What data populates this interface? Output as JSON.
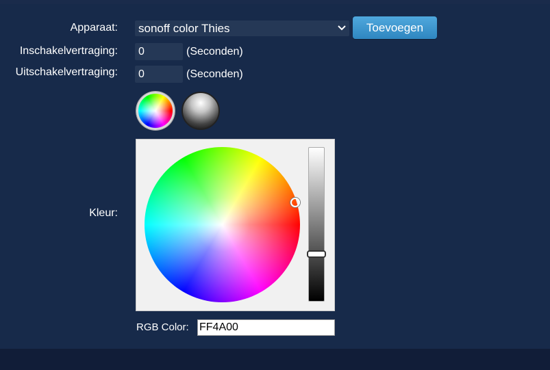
{
  "form": {
    "device_label": "Apparaat:",
    "device_value": "sonoff color Thies",
    "add_button": "Toevoegen",
    "on_delay_label": "Inschakelvertraging:",
    "on_delay_value": "0",
    "on_delay_unit": "(Seconden)",
    "off_delay_label": "Uitschakelvertraging:",
    "off_delay_value": "0",
    "off_delay_unit": "(Seconden)",
    "color_label": "Kleur:",
    "rgb_label": "RGB Color:",
    "rgb_value": "FF4A00"
  },
  "icons": {
    "dropdown": "chevron-down-icon",
    "color_mode": "color-wheel-mode-icon",
    "white_mode": "white-mode-icon"
  },
  "colors": {
    "background": "#172a4a",
    "button": "#3a93cd",
    "selected_color": "#FF4A00"
  },
  "picker": {
    "brightness_level": 0.25
  }
}
